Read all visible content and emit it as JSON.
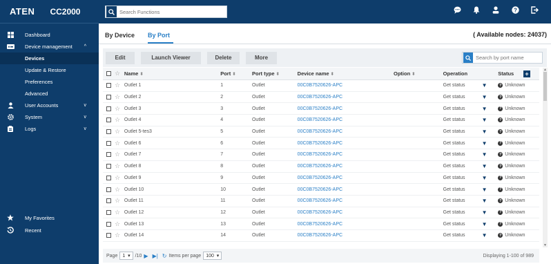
{
  "brand": {
    "logo": "ATEN",
    "model": "CC2000"
  },
  "sidebar": {
    "items": [
      {
        "label": "Dashboard",
        "icon": "dashboard-icon"
      },
      {
        "label": "Device management",
        "icon": "device-icon",
        "chevron": "^"
      },
      {
        "label": "User Accounts",
        "icon": "user-icon",
        "chevron": "v"
      },
      {
        "label": "System",
        "icon": "gear-icon",
        "chevron": "v"
      },
      {
        "label": "Logs",
        "icon": "clipboard-icon",
        "chevron": "v"
      }
    ],
    "subitems": [
      {
        "label": "Devices",
        "active": true
      },
      {
        "label": "Update & Restore"
      },
      {
        "label": "Preferences"
      },
      {
        "label": "Advanced"
      }
    ],
    "bottom": [
      {
        "label": "My Favorites",
        "icon": "star-icon"
      },
      {
        "label": "Recent",
        "icon": "history-icon"
      }
    ]
  },
  "header": {
    "search_placeholder": "Search Functions",
    "icons": [
      "chat-icon",
      "bell-icon",
      "user-icon",
      "help-icon",
      "logout-icon"
    ]
  },
  "tabs": [
    {
      "label": "By Device",
      "active": false
    },
    {
      "label": "By Port",
      "active": true
    }
  ],
  "available_nodes": "( Available nodes: 24037)",
  "toolbar": {
    "edit": "Edit",
    "launch_viewer": "Launch Viewer",
    "delete": "Delete",
    "more": "More",
    "port_search_placeholder": "Search by port name"
  },
  "table": {
    "headers": {
      "name": "Name",
      "port": "Port",
      "port_type": "Port type",
      "device_name": "Device name",
      "option": "Option",
      "operation": "Operation",
      "status": "Status"
    },
    "rows": [
      {
        "name": "Outlet 1",
        "port": "1",
        "port_type": "Outlet",
        "device": "00C0B7520626-APC",
        "operation": "Get status",
        "status": "Unknown"
      },
      {
        "name": "Outlet 2",
        "port": "2",
        "port_type": "Outlet",
        "device": "00C0B7520626-APC",
        "operation": "Get status",
        "status": "Unknown"
      },
      {
        "name": "Outlet 3",
        "port": "3",
        "port_type": "Outlet",
        "device": "00C0B7520626-APC",
        "operation": "Get status",
        "status": "Unknown"
      },
      {
        "name": "Outlet 4",
        "port": "4",
        "port_type": "Outlet",
        "device": "00C0B7520626-APC",
        "operation": "Get status",
        "status": "Unknown"
      },
      {
        "name": "Outlet 5-tes3",
        "port": "5",
        "port_type": "Outlet",
        "device": "00C0B7520626-APC",
        "operation": "Get status",
        "status": "Unknown"
      },
      {
        "name": "Outlet 6",
        "port": "6",
        "port_type": "Outlet",
        "device": "00C0B7520626-APC",
        "operation": "Get status",
        "status": "Unknown"
      },
      {
        "name": "Outlet 7",
        "port": "7",
        "port_type": "Outlet",
        "device": "00C0B7520626-APC",
        "operation": "Get status",
        "status": "Unknown"
      },
      {
        "name": "Outlet 8",
        "port": "8",
        "port_type": "Outlet",
        "device": "00C0B7520626-APC",
        "operation": "Get status",
        "status": "Unknown"
      },
      {
        "name": "Outlet 9",
        "port": "9",
        "port_type": "Outlet",
        "device": "00C0B7520626-APC",
        "operation": "Get status",
        "status": "Unknown"
      },
      {
        "name": "Outlet 10",
        "port": "10",
        "port_type": "Outlet",
        "device": "00C0B7520626-APC",
        "operation": "Get status",
        "status": "Unknown"
      },
      {
        "name": "Outlet 11",
        "port": "11",
        "port_type": "Outlet",
        "device": "00C0B7520626-APC",
        "operation": "Get status",
        "status": "Unknown"
      },
      {
        "name": "Outlet 12",
        "port": "12",
        "port_type": "Outlet",
        "device": "00C0B7520626-APC",
        "operation": "Get status",
        "status": "Unknown"
      },
      {
        "name": "Outlet 13",
        "port": "13",
        "port_type": "Outlet",
        "device": "00C0B7520626-APC",
        "operation": "Get status",
        "status": "Unknown"
      },
      {
        "name": "Outlet 14",
        "port": "14",
        "port_type": "Outlet",
        "device": "00C0B7520626-APC",
        "operation": "Get status",
        "status": "Unknown"
      }
    ]
  },
  "pager": {
    "page_label": "Page",
    "page_value": "1",
    "page_total": "/10",
    "items_label": "Items per page",
    "items_value": "100",
    "info": "Displaying 1-100 of 989"
  },
  "colors": {
    "sidebar": "#0e3d6b",
    "accent": "#2a7fc6",
    "link": "#2a7fc6"
  }
}
